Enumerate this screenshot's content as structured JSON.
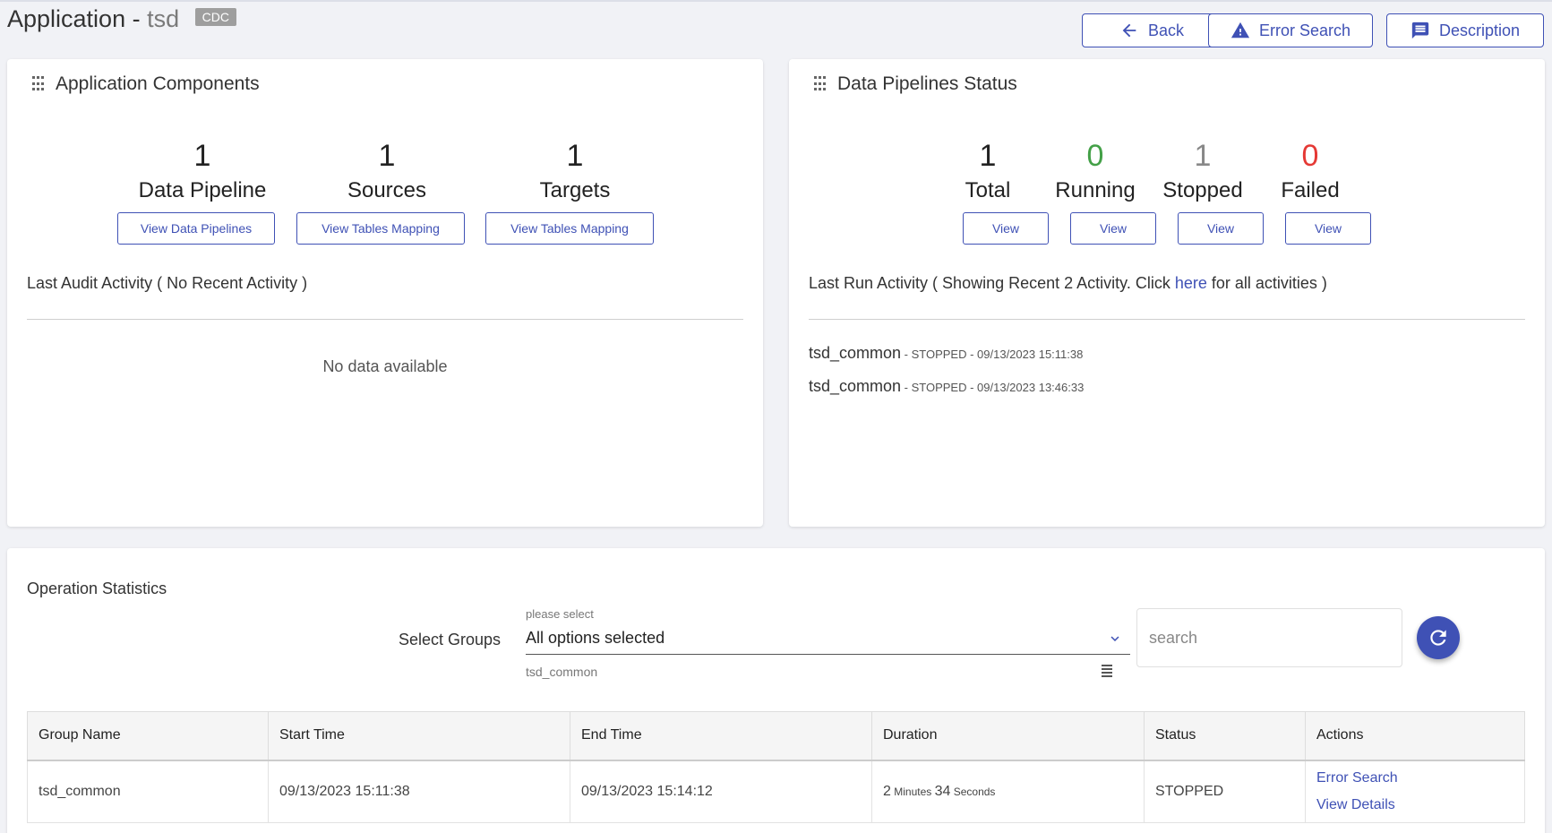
{
  "header": {
    "title_prefix": "Application - ",
    "app_name": "tsd",
    "badge": "CDC",
    "back_label": "Back",
    "error_search_label": "Error Search",
    "description_label": "Description"
  },
  "components": {
    "title": "Application Components",
    "stats": [
      {
        "value": "1",
        "label": "Data Pipeline",
        "button": "View Data Pipelines"
      },
      {
        "value": "1",
        "label": "Sources",
        "button": "View Tables Mapping"
      },
      {
        "value": "1",
        "label": "Targets",
        "button": "View Tables Mapping"
      }
    ],
    "audit_label": "Last Audit Activity ( No Recent Activity )",
    "no_data": "No data available"
  },
  "pipelines": {
    "title": "Data Pipelines Status",
    "stats": [
      {
        "value": "1",
        "label": "Total",
        "button": "View",
        "color": "#222222"
      },
      {
        "value": "0",
        "label": "Running",
        "button": "View",
        "color": "#43a047"
      },
      {
        "value": "1",
        "label": "Stopped",
        "button": "View",
        "color": "#888888"
      },
      {
        "value": "0",
        "label": "Failed",
        "button": "View",
        "color": "#e53935"
      }
    ],
    "run_label_prefix": "Last Run Activity ( Showing Recent 2 Activity. Click ",
    "run_label_link": "here",
    "run_label_suffix": " for all activities )",
    "runs": [
      {
        "name": "tsd_common",
        "meta": " - STOPPED - 09/13/2023 15:11:38"
      },
      {
        "name": "tsd_common",
        "meta": " - STOPPED - 09/13/2023 13:46:33"
      }
    ]
  },
  "operations": {
    "title": "Operation Statistics",
    "select_label": "Select Groups",
    "select_hint": "please select",
    "select_value": "All options selected",
    "selected_item": "tsd_common",
    "search_placeholder": "search",
    "columns": [
      "Group Name",
      "Start Time",
      "End Time",
      "Duration",
      "Status",
      "Actions"
    ],
    "rows": [
      {
        "group": "tsd_common",
        "start": "09/13/2023 15:11:38",
        "end": "09/13/2023 15:14:12",
        "duration_min": "2",
        "duration_min_unit": " Minutes ",
        "duration_sec": "34",
        "duration_sec_unit": " Seconds",
        "status": "STOPPED",
        "action1": "Error Search",
        "action2": "View Details"
      }
    ]
  },
  "colors": {
    "accent": "#3f51b5",
    "running": "#43a047",
    "failed": "#e53935"
  }
}
